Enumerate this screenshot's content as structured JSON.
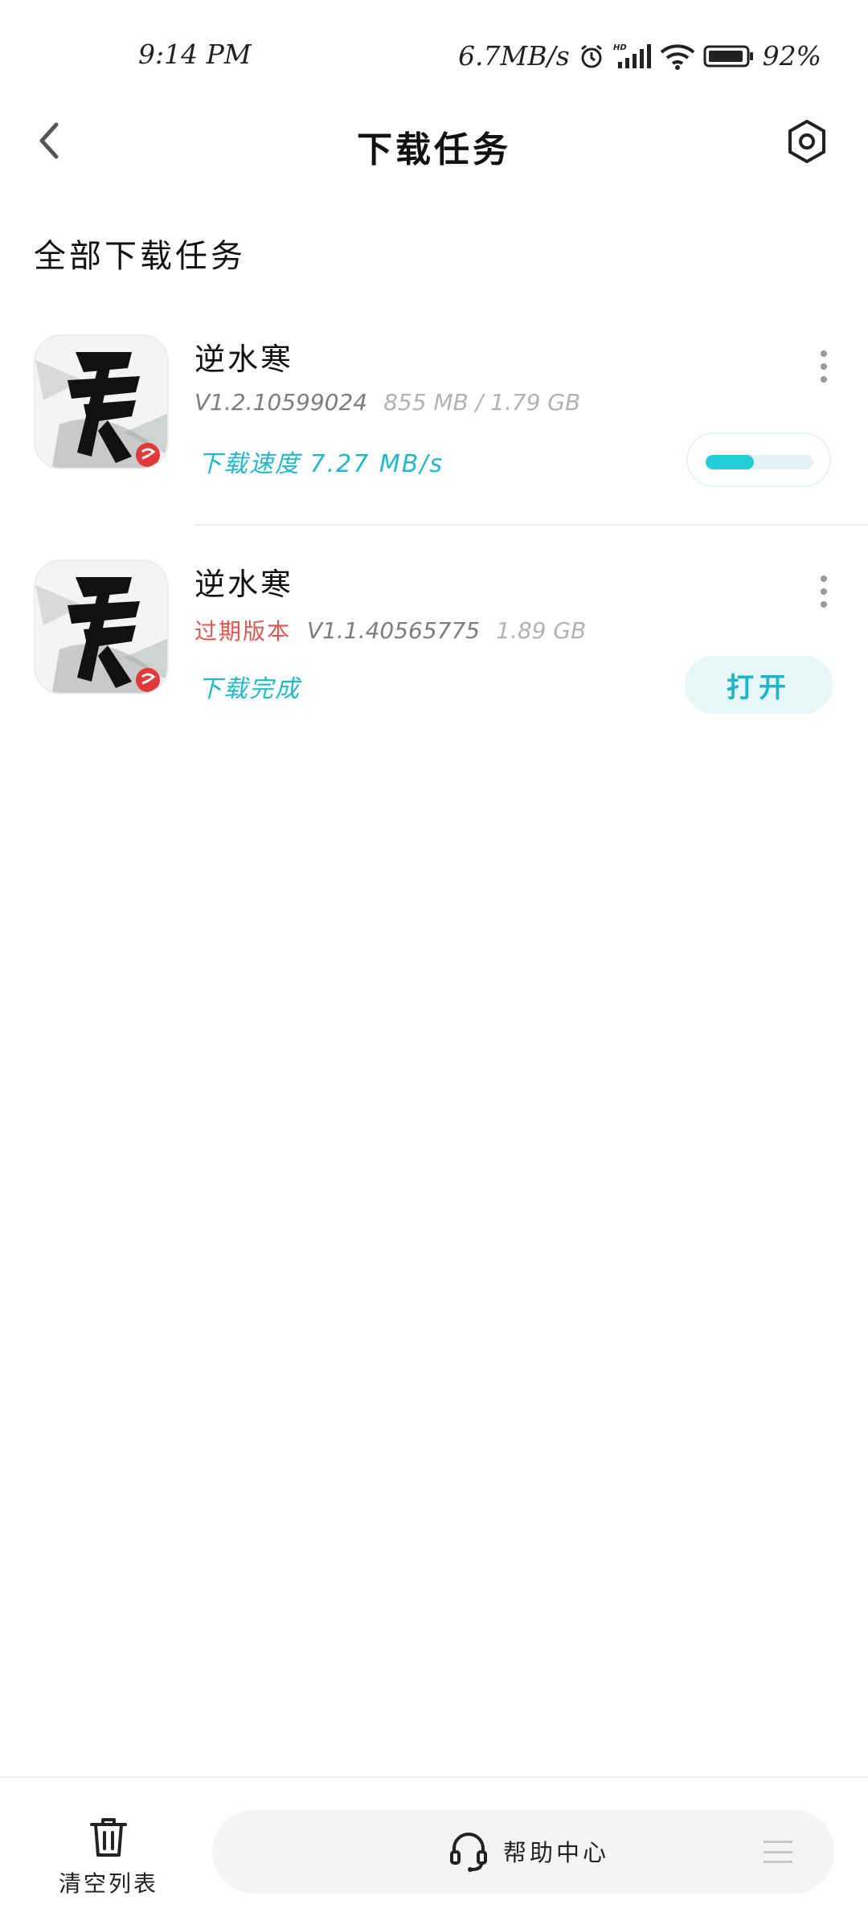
{
  "status_bar": {
    "time": "9:14 PM",
    "net_speed": "6.7MB/s",
    "battery": "92%",
    "icons": [
      "alarm-icon",
      "hd-signal-icon",
      "wifi-icon",
      "battery-icon"
    ]
  },
  "header": {
    "title": "下载任务",
    "back_icon": "chevron-left-icon",
    "settings_icon": "hexagon-settings-icon"
  },
  "section_title": "全部下载任务",
  "tasks": [
    {
      "name": "逆水寒",
      "version": "V1.2.10599024",
      "size": "855 MB / 1.79 GB",
      "status": "下载速度 7.27 MB/s",
      "progress": 0.45
    },
    {
      "name": "逆水寒",
      "outdated_label": "过期版本",
      "version": "V1.1.40565775",
      "size": "1.89 GB",
      "status": "下载完成",
      "action": "打开"
    }
  ],
  "bottom": {
    "clear_label": "清空列表",
    "help_label": "帮助中心"
  },
  "colors": {
    "accent": "#22b8c8",
    "outdated": "#e2564f",
    "progress": "#22cdd8"
  }
}
